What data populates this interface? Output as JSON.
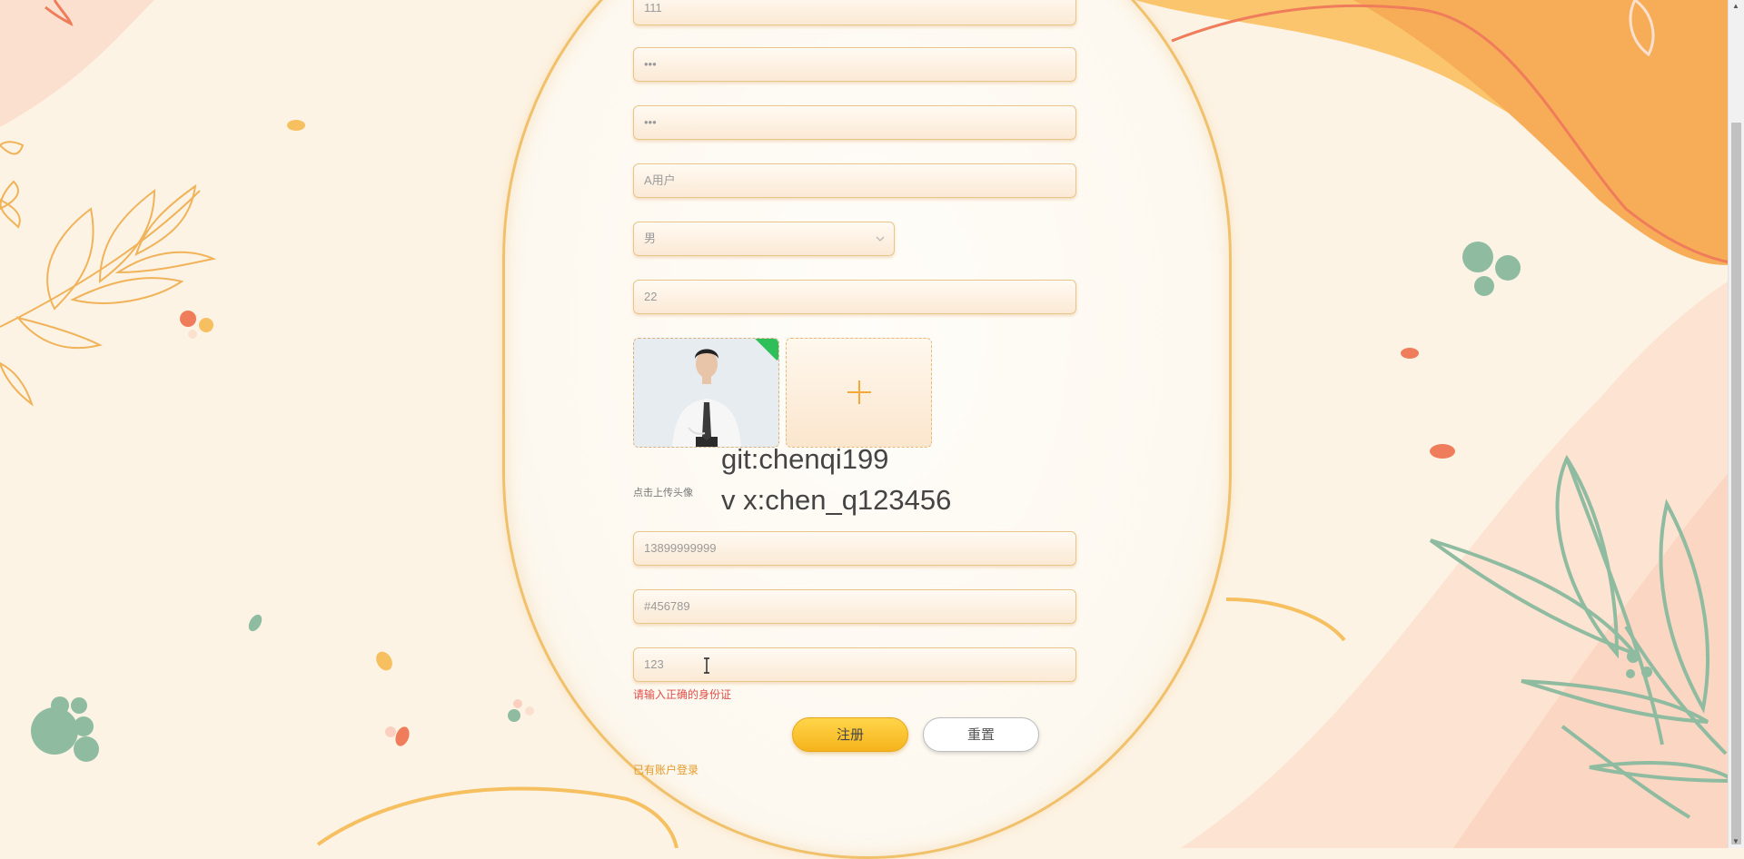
{
  "form": {
    "fields": [
      {
        "value": "111"
      },
      {
        "value": "•••"
      },
      {
        "value": "•••"
      },
      {
        "value": "A用户"
      }
    ],
    "gender": {
      "selected": "男"
    },
    "age": "22",
    "avatar_hint": "点击上传头像",
    "upload_icon": "plus-icon",
    "phone": "13899999999",
    "color_or_code": "#456789",
    "id_card": "123",
    "id_card_error": "请输入正确的身份证",
    "register_label": "注册",
    "reset_label": "重置",
    "login_link": "已有账户登录"
  },
  "watermark": {
    "line1": "git:chenqi199",
    "line2": "v x:chen_q123456"
  },
  "colors": {
    "accent": "#f5b31c",
    "error": "#e0504a",
    "link": "#e59a2a",
    "leaf_green": "#8fbca1",
    "leaf_orange": "#f2b15a",
    "coral": "#f07d5f"
  }
}
